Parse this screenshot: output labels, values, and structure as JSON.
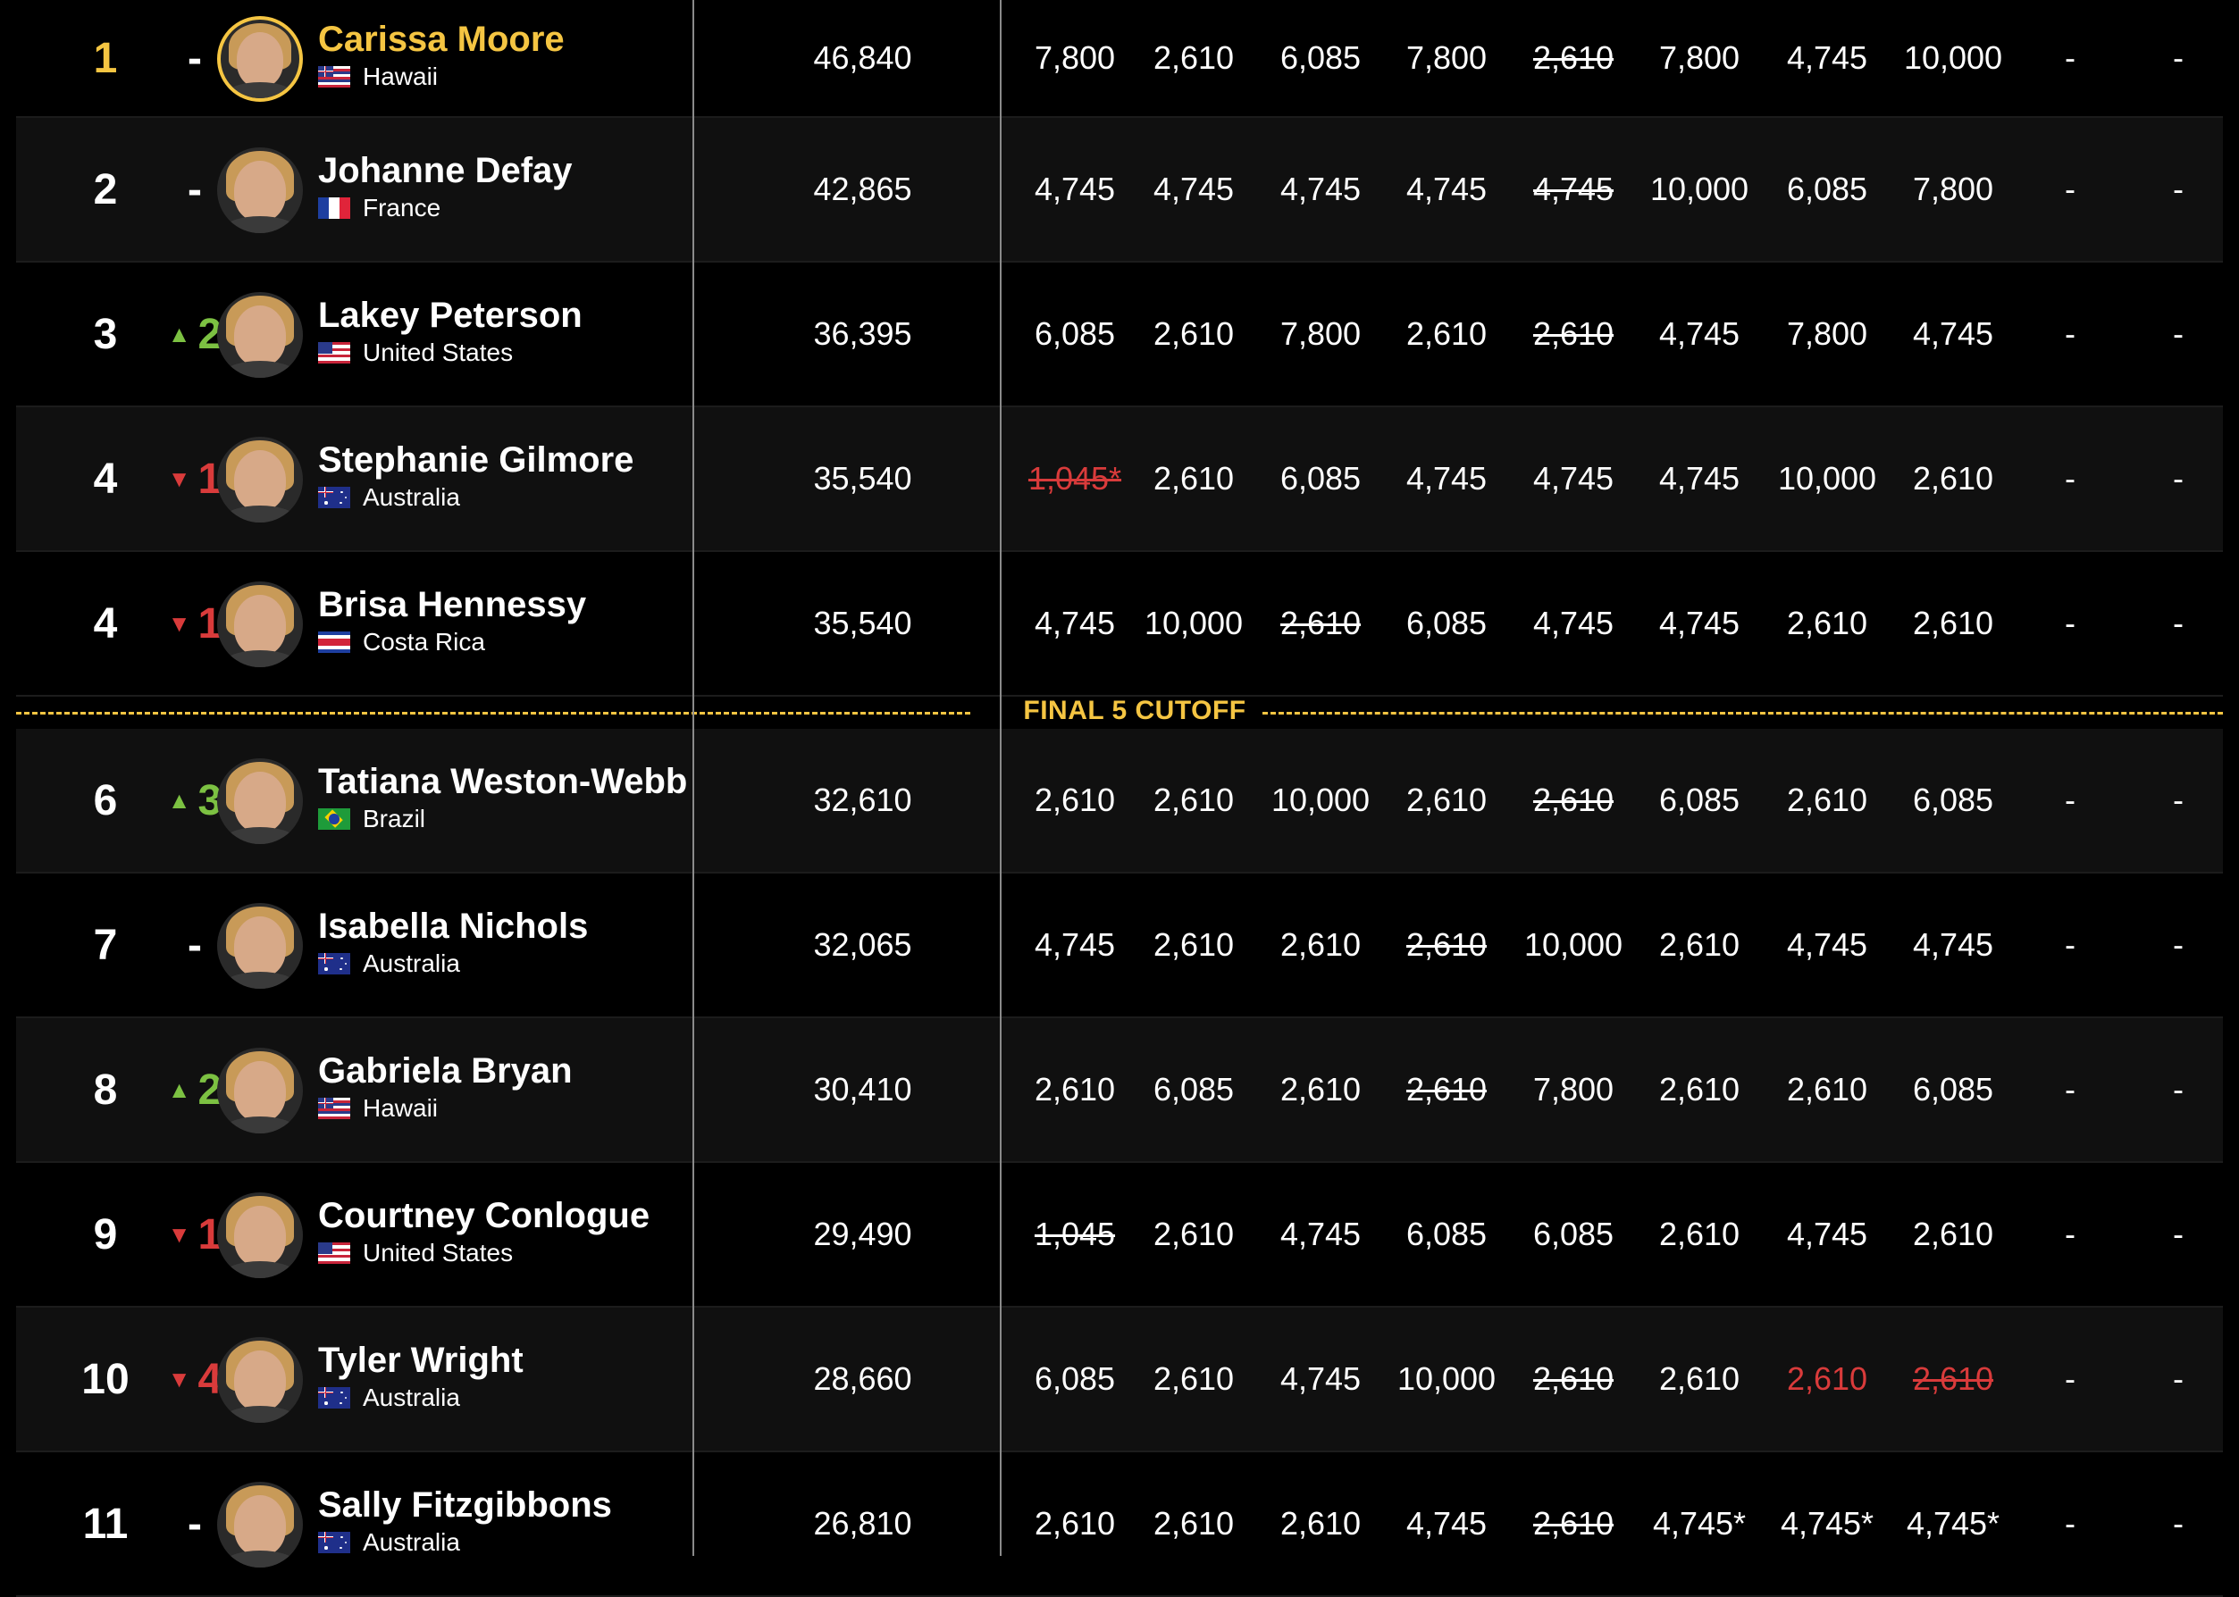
{
  "cutoff_label": "FINAL 5 CUTOFF",
  "colors": {
    "gold": "#f5c542",
    "up": "#7cc142",
    "down": "#d93b3b",
    "row_alt": "#101010"
  },
  "rows": [
    {
      "rank": "1",
      "move": {
        "dir": "none",
        "text": "-"
      },
      "name": "Carissa Moore",
      "country": "Hawaii",
      "flag": "hawaii-flag",
      "leader": true,
      "total": "46,840",
      "scores": [
        {
          "v": "7,800"
        },
        {
          "v": "2,610"
        },
        {
          "v": "6,085"
        },
        {
          "v": "7,800"
        },
        {
          "v": "2,610",
          "drop": true
        },
        {
          "v": "7,800"
        },
        {
          "v": "4,745"
        },
        {
          "v": "10,000"
        },
        {
          "v": "-"
        },
        {
          "v": "-"
        }
      ]
    },
    {
      "rank": "2",
      "move": {
        "dir": "none",
        "text": "-"
      },
      "name": "Johanne Defay",
      "country": "France",
      "flag": "france-flag",
      "total": "42,865",
      "scores": [
        {
          "v": "4,745"
        },
        {
          "v": "4,745"
        },
        {
          "v": "4,745"
        },
        {
          "v": "4,745"
        },
        {
          "v": "4,745",
          "drop": true
        },
        {
          "v": "10,000"
        },
        {
          "v": "6,085"
        },
        {
          "v": "7,800"
        },
        {
          "v": "-"
        },
        {
          "v": "-"
        }
      ]
    },
    {
      "rank": "3",
      "move": {
        "dir": "up",
        "text": "2"
      },
      "name": "Lakey Peterson",
      "country": "United States",
      "flag": "usa-flag",
      "total": "36,395",
      "scores": [
        {
          "v": "6,085"
        },
        {
          "v": "2,610"
        },
        {
          "v": "7,800"
        },
        {
          "v": "2,610"
        },
        {
          "v": "2,610",
          "drop": true
        },
        {
          "v": "4,745"
        },
        {
          "v": "7,800"
        },
        {
          "v": "4,745"
        },
        {
          "v": "-"
        },
        {
          "v": "-"
        }
      ]
    },
    {
      "rank": "4",
      "move": {
        "dir": "down",
        "text": "1"
      },
      "name": "Stephanie Gilmore",
      "country": "Australia",
      "flag": "australia-flag",
      "total": "35,540",
      "scores": [
        {
          "v": "1,045*",
          "drop": true,
          "red": true
        },
        {
          "v": "2,610"
        },
        {
          "v": "6,085"
        },
        {
          "v": "4,745"
        },
        {
          "v": "4,745"
        },
        {
          "v": "4,745"
        },
        {
          "v": "10,000"
        },
        {
          "v": "2,610"
        },
        {
          "v": "-"
        },
        {
          "v": "-"
        }
      ]
    },
    {
      "rank": "4",
      "move": {
        "dir": "down",
        "text": "1"
      },
      "name": "Brisa Hennessy",
      "country": "Costa Rica",
      "flag": "costa-rica-flag",
      "total": "35,540",
      "scores": [
        {
          "v": "4,745"
        },
        {
          "v": "10,000"
        },
        {
          "v": "2,610",
          "drop": true
        },
        {
          "v": "6,085"
        },
        {
          "v": "4,745"
        },
        {
          "v": "4,745"
        },
        {
          "v": "2,610"
        },
        {
          "v": "2,610"
        },
        {
          "v": "-"
        },
        {
          "v": "-"
        }
      ]
    },
    {
      "rank": "6",
      "move": {
        "dir": "up",
        "text": "3"
      },
      "name": "Tatiana Weston-Webb",
      "country": "Brazil",
      "flag": "brazil-flag",
      "total": "32,610",
      "scores": [
        {
          "v": "2,610"
        },
        {
          "v": "2,610"
        },
        {
          "v": "10,000"
        },
        {
          "v": "2,610"
        },
        {
          "v": "2,610",
          "drop": true
        },
        {
          "v": "6,085"
        },
        {
          "v": "2,610"
        },
        {
          "v": "6,085"
        },
        {
          "v": "-"
        },
        {
          "v": "-"
        }
      ]
    },
    {
      "rank": "7",
      "move": {
        "dir": "none",
        "text": "-"
      },
      "name": "Isabella Nichols",
      "country": "Australia",
      "flag": "australia-flag",
      "total": "32,065",
      "scores": [
        {
          "v": "4,745"
        },
        {
          "v": "2,610"
        },
        {
          "v": "2,610"
        },
        {
          "v": "2,610",
          "drop": true
        },
        {
          "v": "10,000"
        },
        {
          "v": "2,610"
        },
        {
          "v": "4,745"
        },
        {
          "v": "4,745"
        },
        {
          "v": "-"
        },
        {
          "v": "-"
        }
      ]
    },
    {
      "rank": "8",
      "move": {
        "dir": "up",
        "text": "2"
      },
      "name": "Gabriela Bryan",
      "country": "Hawaii",
      "flag": "hawaii-flag",
      "total": "30,410",
      "scores": [
        {
          "v": "2,610"
        },
        {
          "v": "6,085"
        },
        {
          "v": "2,610"
        },
        {
          "v": "2,610",
          "drop": true
        },
        {
          "v": "7,800"
        },
        {
          "v": "2,610"
        },
        {
          "v": "2,610"
        },
        {
          "v": "6,085"
        },
        {
          "v": "-"
        },
        {
          "v": "-"
        }
      ]
    },
    {
      "rank": "9",
      "move": {
        "dir": "down",
        "text": "1"
      },
      "name": "Courtney Conlogue",
      "country": "United States",
      "flag": "usa-flag",
      "total": "29,490",
      "scores": [
        {
          "v": "1,045",
          "drop": true
        },
        {
          "v": "2,610"
        },
        {
          "v": "4,745"
        },
        {
          "v": "6,085"
        },
        {
          "v": "6,085"
        },
        {
          "v": "2,610"
        },
        {
          "v": "4,745"
        },
        {
          "v": "2,610"
        },
        {
          "v": "-"
        },
        {
          "v": "-"
        }
      ]
    },
    {
      "rank": "10",
      "move": {
        "dir": "down",
        "text": "4"
      },
      "name": "Tyler Wright",
      "country": "Australia",
      "flag": "australia-flag",
      "total": "28,660",
      "scores": [
        {
          "v": "6,085"
        },
        {
          "v": "2,610"
        },
        {
          "v": "4,745"
        },
        {
          "v": "10,000"
        },
        {
          "v": "2,610",
          "drop": true
        },
        {
          "v": "2,610"
        },
        {
          "v": "2,610",
          "red": true
        },
        {
          "v": "2,610",
          "drop": true,
          "red": true
        },
        {
          "v": "-"
        },
        {
          "v": "-"
        }
      ]
    },
    {
      "rank": "11",
      "move": {
        "dir": "none",
        "text": "-"
      },
      "name": "Sally Fitzgibbons",
      "country": "Australia",
      "flag": "australia-flag",
      "total": "26,810",
      "scores": [
        {
          "v": "2,610"
        },
        {
          "v": "2,610"
        },
        {
          "v": "2,610"
        },
        {
          "v": "4,745"
        },
        {
          "v": "2,610",
          "drop": true
        },
        {
          "v": "4,745*"
        },
        {
          "v": "4,745*"
        },
        {
          "v": "4,745*"
        },
        {
          "v": "-"
        },
        {
          "v": "-"
        }
      ]
    }
  ]
}
